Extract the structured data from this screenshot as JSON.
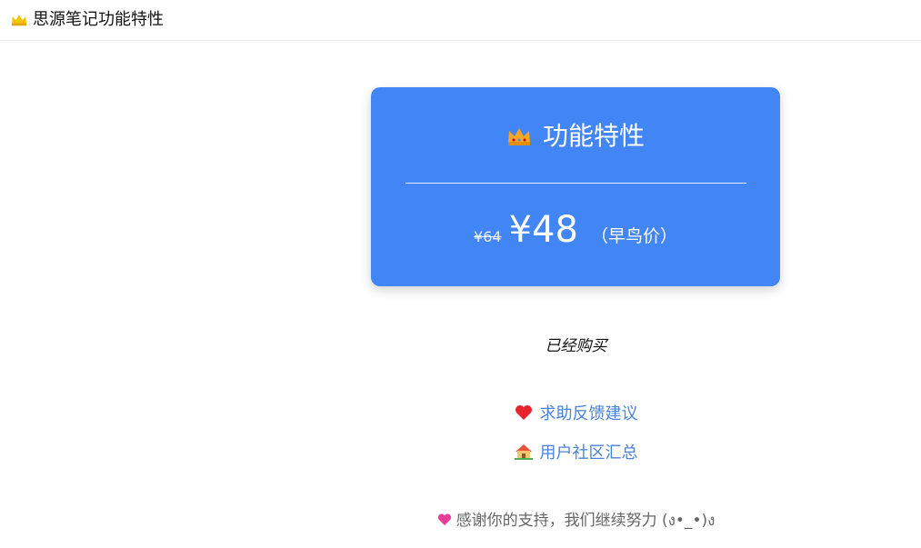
{
  "header": {
    "title": "思源笔记功能特性",
    "icon": "crown-icon"
  },
  "card": {
    "icon": "crown-icon",
    "title": "功能特性",
    "old_price": "¥64",
    "price": "¥48",
    "price_note": "（早鸟价）",
    "background": "#4285f4"
  },
  "status": {
    "purchased": "已经购买"
  },
  "links": {
    "feedback": {
      "icon": "red-heart-icon",
      "label": "求助反馈建议"
    },
    "community": {
      "icon": "house-icon",
      "label": "用户社区汇总"
    }
  },
  "footer": {
    "icon": "pink-heart-icon",
    "thanks": "感谢你的支持，我们继续努力 (ง•_•)ง"
  }
}
